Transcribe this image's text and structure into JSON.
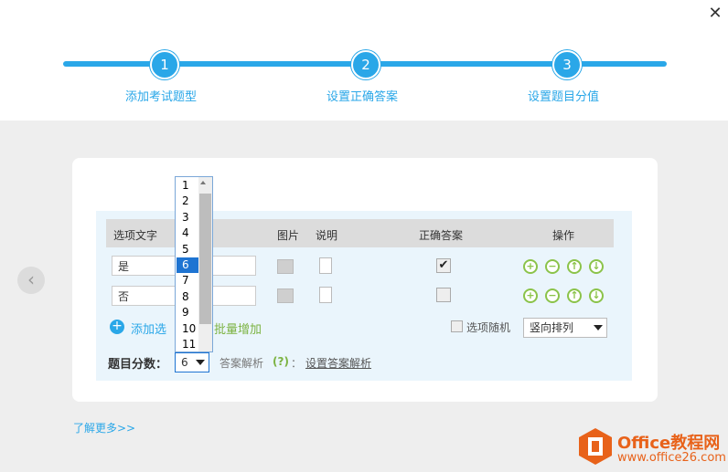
{
  "dialog": {
    "close_label": "✕"
  },
  "steps": [
    {
      "number": "1",
      "label": "添加考试题型"
    },
    {
      "number": "2",
      "label": "设置正确答案"
    },
    {
      "number": "3",
      "label": "设置题目分值"
    }
  ],
  "table": {
    "headers": {
      "option_text": "选项文字",
      "image": "图片",
      "note": "说明",
      "correct": "正确答案",
      "actions": "操作"
    },
    "rows": [
      {
        "text": "是",
        "correct": true
      },
      {
        "text": "否",
        "correct": false
      }
    ],
    "action_icons": [
      "add-icon",
      "remove-icon",
      "move-up-icon",
      "move-down-icon"
    ]
  },
  "controls": {
    "add_option_label": "添加选",
    "batch_add_label": "批量增加",
    "random_label": "选项随机",
    "order_select": "竖向排列",
    "score_label": "题目分数：",
    "score_value": "6",
    "analysis_label": "答案解析",
    "analysis_help": "(?)",
    "analysis_colon": "：",
    "analysis_link": "设置答案解析"
  },
  "score_dropdown": {
    "options": [
      "1",
      "2",
      "3",
      "4",
      "5",
      "6",
      "7",
      "8",
      "9",
      "10",
      "11"
    ],
    "selected": "6"
  },
  "footer": {
    "learn_more": "了解更多>>"
  },
  "logo": {
    "name": "Office教程网",
    "url_text": "www.office26.com"
  },
  "colors": {
    "accent": "#2aa7e8",
    "green": "#8bc34a",
    "selected": "#1e74d2",
    "logo": "#e8621a"
  }
}
